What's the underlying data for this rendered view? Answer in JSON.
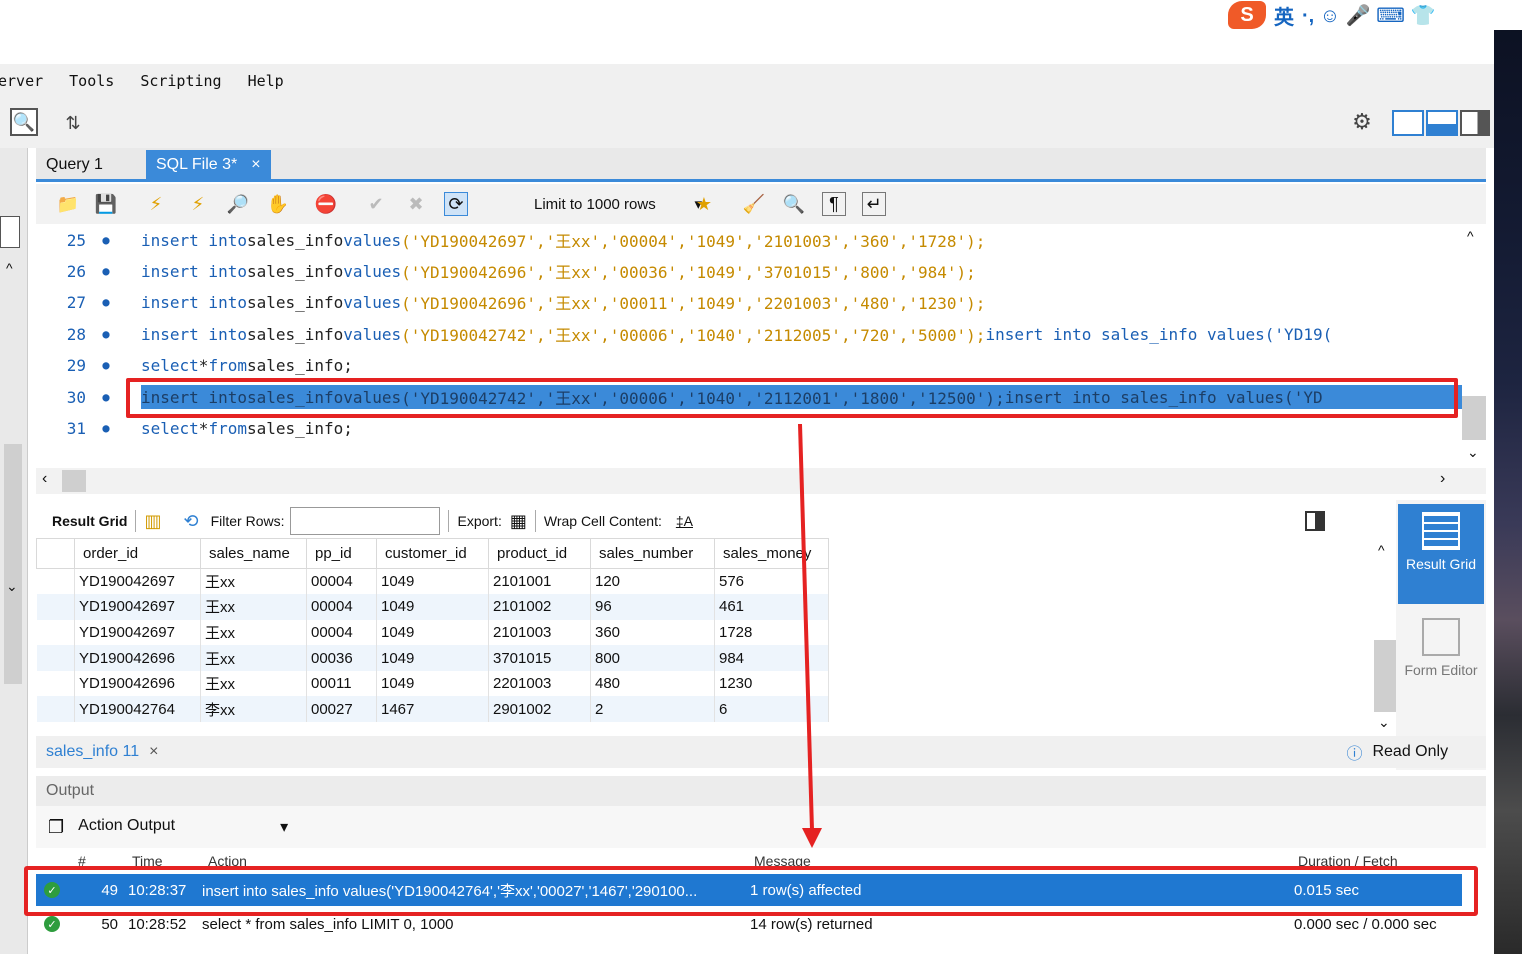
{
  "ime": {
    "lang_glyph": "英",
    "extra": "·, ☺ 🎤 ⌨ 👕"
  },
  "menu": {
    "items": [
      "erver",
      "Tools",
      "Scripting",
      "Help"
    ]
  },
  "tabs": {
    "items": [
      {
        "label": "Query 1"
      },
      {
        "label": "SQL File 3*"
      }
    ],
    "close": "×"
  },
  "editor_toolbar": {
    "limit_label": "Limit to 1000 rows"
  },
  "editor": {
    "lines": [
      {
        "n": "25",
        "kw1": "insert into",
        "t1": " sales_info ",
        "kw2": "values",
        "str": "('YD190042697','王xx','00004','1049','2101003','360','1728');",
        "rest": ""
      },
      {
        "n": "26",
        "kw1": "insert into",
        "t1": " sales_info ",
        "kw2": "values",
        "str": "('YD190042696','王xx','00036','1049','3701015','800','984');",
        "rest": ""
      },
      {
        "n": "27",
        "kw1": "insert into",
        "t1": " sales_info ",
        "kw2": "values",
        "str": "('YD190042696','王xx','00011','1049','2201003','480','1230');",
        "rest": ""
      },
      {
        "n": "28",
        "kw1": "insert into",
        "t1": " sales_info ",
        "kw2": "values",
        "str": "('YD190042742','王xx','00006','1040','2112005','720','5000');",
        "rest": "insert into sales_info values('YD19("
      },
      {
        "n": "29",
        "kw1": "select",
        "t1": " * ",
        "kw2": "from",
        "str": "",
        "rest": " sales_info;"
      },
      {
        "n": "30",
        "kw1": "insert into",
        "t1": " sales_info ",
        "kw2": "values",
        "str": "('YD190042742','王xx','00006','1040','2112001','1800','12500');",
        "rest": "insert into sales_info values('YD"
      },
      {
        "n": "31",
        "kw1": "select",
        "t1": " * ",
        "kw2": "from",
        "str": "",
        "rest": " sales_info;"
      }
    ]
  },
  "result_toolbar": {
    "result_grid": "Result Grid",
    "filter_rows": "Filter Rows:",
    "export": "Export:",
    "wrap": "Wrap Cell Content:"
  },
  "grid": {
    "columns": [
      "order_id",
      "sales_name",
      "pp_id",
      "customer_id",
      "product_id",
      "sales_number",
      "sales_money"
    ],
    "rows": [
      [
        "YD190042697",
        "王xx",
        "00004",
        "1049",
        "2101001",
        "120",
        "576"
      ],
      [
        "YD190042697",
        "王xx",
        "00004",
        "1049",
        "2101002",
        "96",
        "461"
      ],
      [
        "YD190042697",
        "王xx",
        "00004",
        "1049",
        "2101003",
        "360",
        "1728"
      ],
      [
        "YD190042696",
        "王xx",
        "00036",
        "1049",
        "3701015",
        "800",
        "984"
      ],
      [
        "YD190042696",
        "王xx",
        "00011",
        "1049",
        "2201003",
        "480",
        "1230"
      ],
      [
        "YD190042764",
        "李xx",
        "00027",
        "1467",
        "2901002",
        "2",
        "6"
      ]
    ]
  },
  "side": {
    "result_grid": "Result Grid",
    "form_editor": "Form Editor"
  },
  "bottom_tab": {
    "label": "sales_info 11",
    "close": "×",
    "read_only": "Read Only"
  },
  "output": {
    "title": "Output",
    "selector": "Action Output",
    "columns": {
      "num": "#",
      "time": "Time",
      "action": "Action",
      "message": "Message",
      "duration": "Duration / Fetch"
    },
    "rows": [
      {
        "num": "49",
        "time": "10:28:37",
        "action": "insert into sales_info values('YD190042764','李xx','00027','1467','290100...",
        "message": "1 row(s) affected",
        "duration": "0.015 sec"
      },
      {
        "num": "50",
        "time": "10:28:52",
        "action": "select * from sales_info LIMIT 0, 1000",
        "message": "14 row(s) returned",
        "duration": "0.000 sec / 0.000 sec"
      }
    ]
  },
  "colors": {
    "accent": "#3b8ad9",
    "highlight": "#1f78d1",
    "annotation": "#e52222",
    "ok": "#2e9d3e"
  }
}
